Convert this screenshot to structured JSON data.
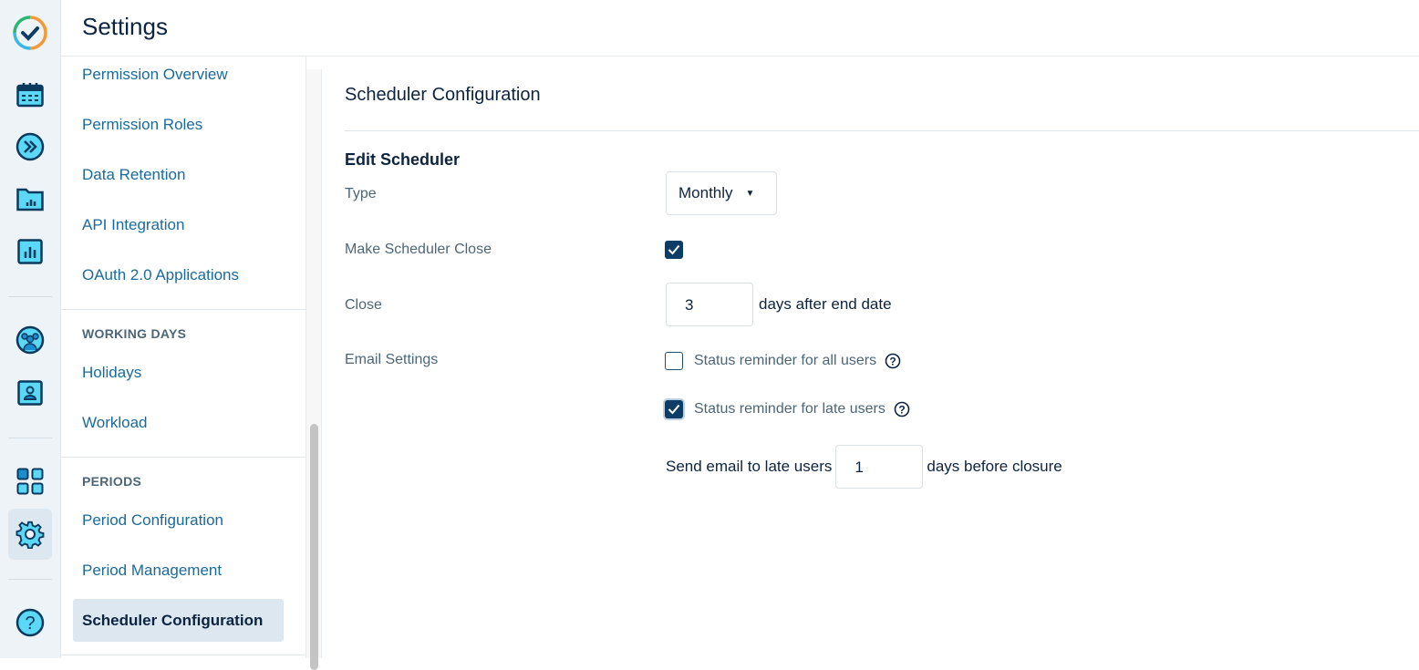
{
  "header": {
    "title": "Settings"
  },
  "rail": {
    "icons": [
      "logo-icon",
      "calendar-icon",
      "fast-forward-icon",
      "folder-chart-icon",
      "bar-chart-icon",
      "team-icon",
      "user-card-icon",
      "apps-grid-icon",
      "gear-icon",
      "help-icon"
    ],
    "accent": "#5ad8f5",
    "stroke": "#0a3a5e"
  },
  "subnav": {
    "items_top": [
      "Permission Overview",
      "Permission Roles",
      "Data Retention",
      "API Integration",
      "OAuth 2.0 Applications"
    ],
    "working_days": {
      "heading": "WORKING DAYS",
      "items": [
        "Holidays",
        "Workload"
      ]
    },
    "periods": {
      "heading": "PERIODS",
      "items": [
        "Period Configuration",
        "Period Management"
      ],
      "selected": "Scheduler Configuration"
    }
  },
  "main": {
    "section_title": "Scheduler Configuration",
    "edit_title": "Edit Scheduler",
    "type": {
      "label": "Type",
      "value": "Monthly"
    },
    "make_close": {
      "label": "Make Scheduler Close",
      "checked": true
    },
    "close": {
      "label": "Close",
      "value": "3",
      "suffix": "days after end date"
    },
    "email": {
      "label": "Email Settings",
      "all_users": {
        "label": "Status reminder for all users",
        "checked": false
      },
      "late_users": {
        "label": "Status reminder for late users",
        "checked": true
      },
      "send": {
        "prefix": "Send email to late users",
        "value": "1",
        "suffix": "days before closure"
      }
    }
  }
}
